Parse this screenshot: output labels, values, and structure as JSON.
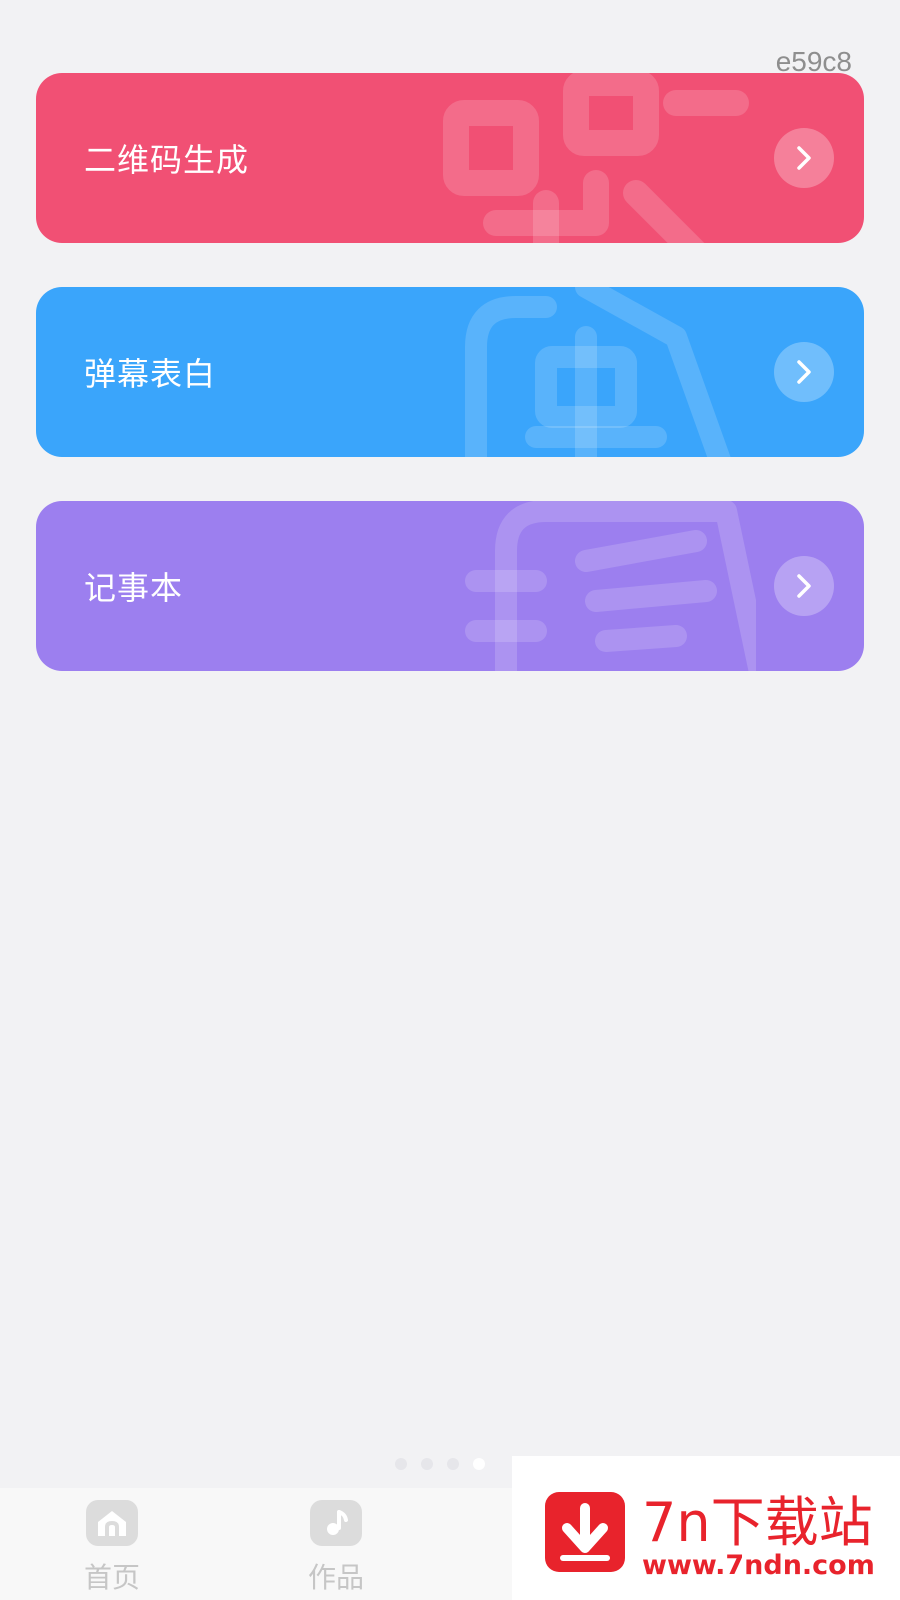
{
  "code_tag": "e59c8",
  "cards": [
    {
      "label": "二维码生成",
      "color": "#f15074",
      "icon": "qr-code-watermark-icon"
    },
    {
      "label": "弹幕表白",
      "color": "#3aa5fb",
      "icon": "danmu-watermark-icon"
    },
    {
      "label": "记事本",
      "color": "#9c7fef",
      "icon": "notebook-watermark-icon"
    }
  ],
  "pager": {
    "count": 4,
    "active_index": 3
  },
  "tabbar": {
    "items": [
      {
        "label": "首页",
        "icon": "home-icon"
      },
      {
        "label": "作品",
        "icon": "music-note-icon"
      }
    ]
  },
  "watermark": {
    "title": "7n下载站",
    "url": "www.7ndn.com",
    "color": "#e8232c"
  }
}
